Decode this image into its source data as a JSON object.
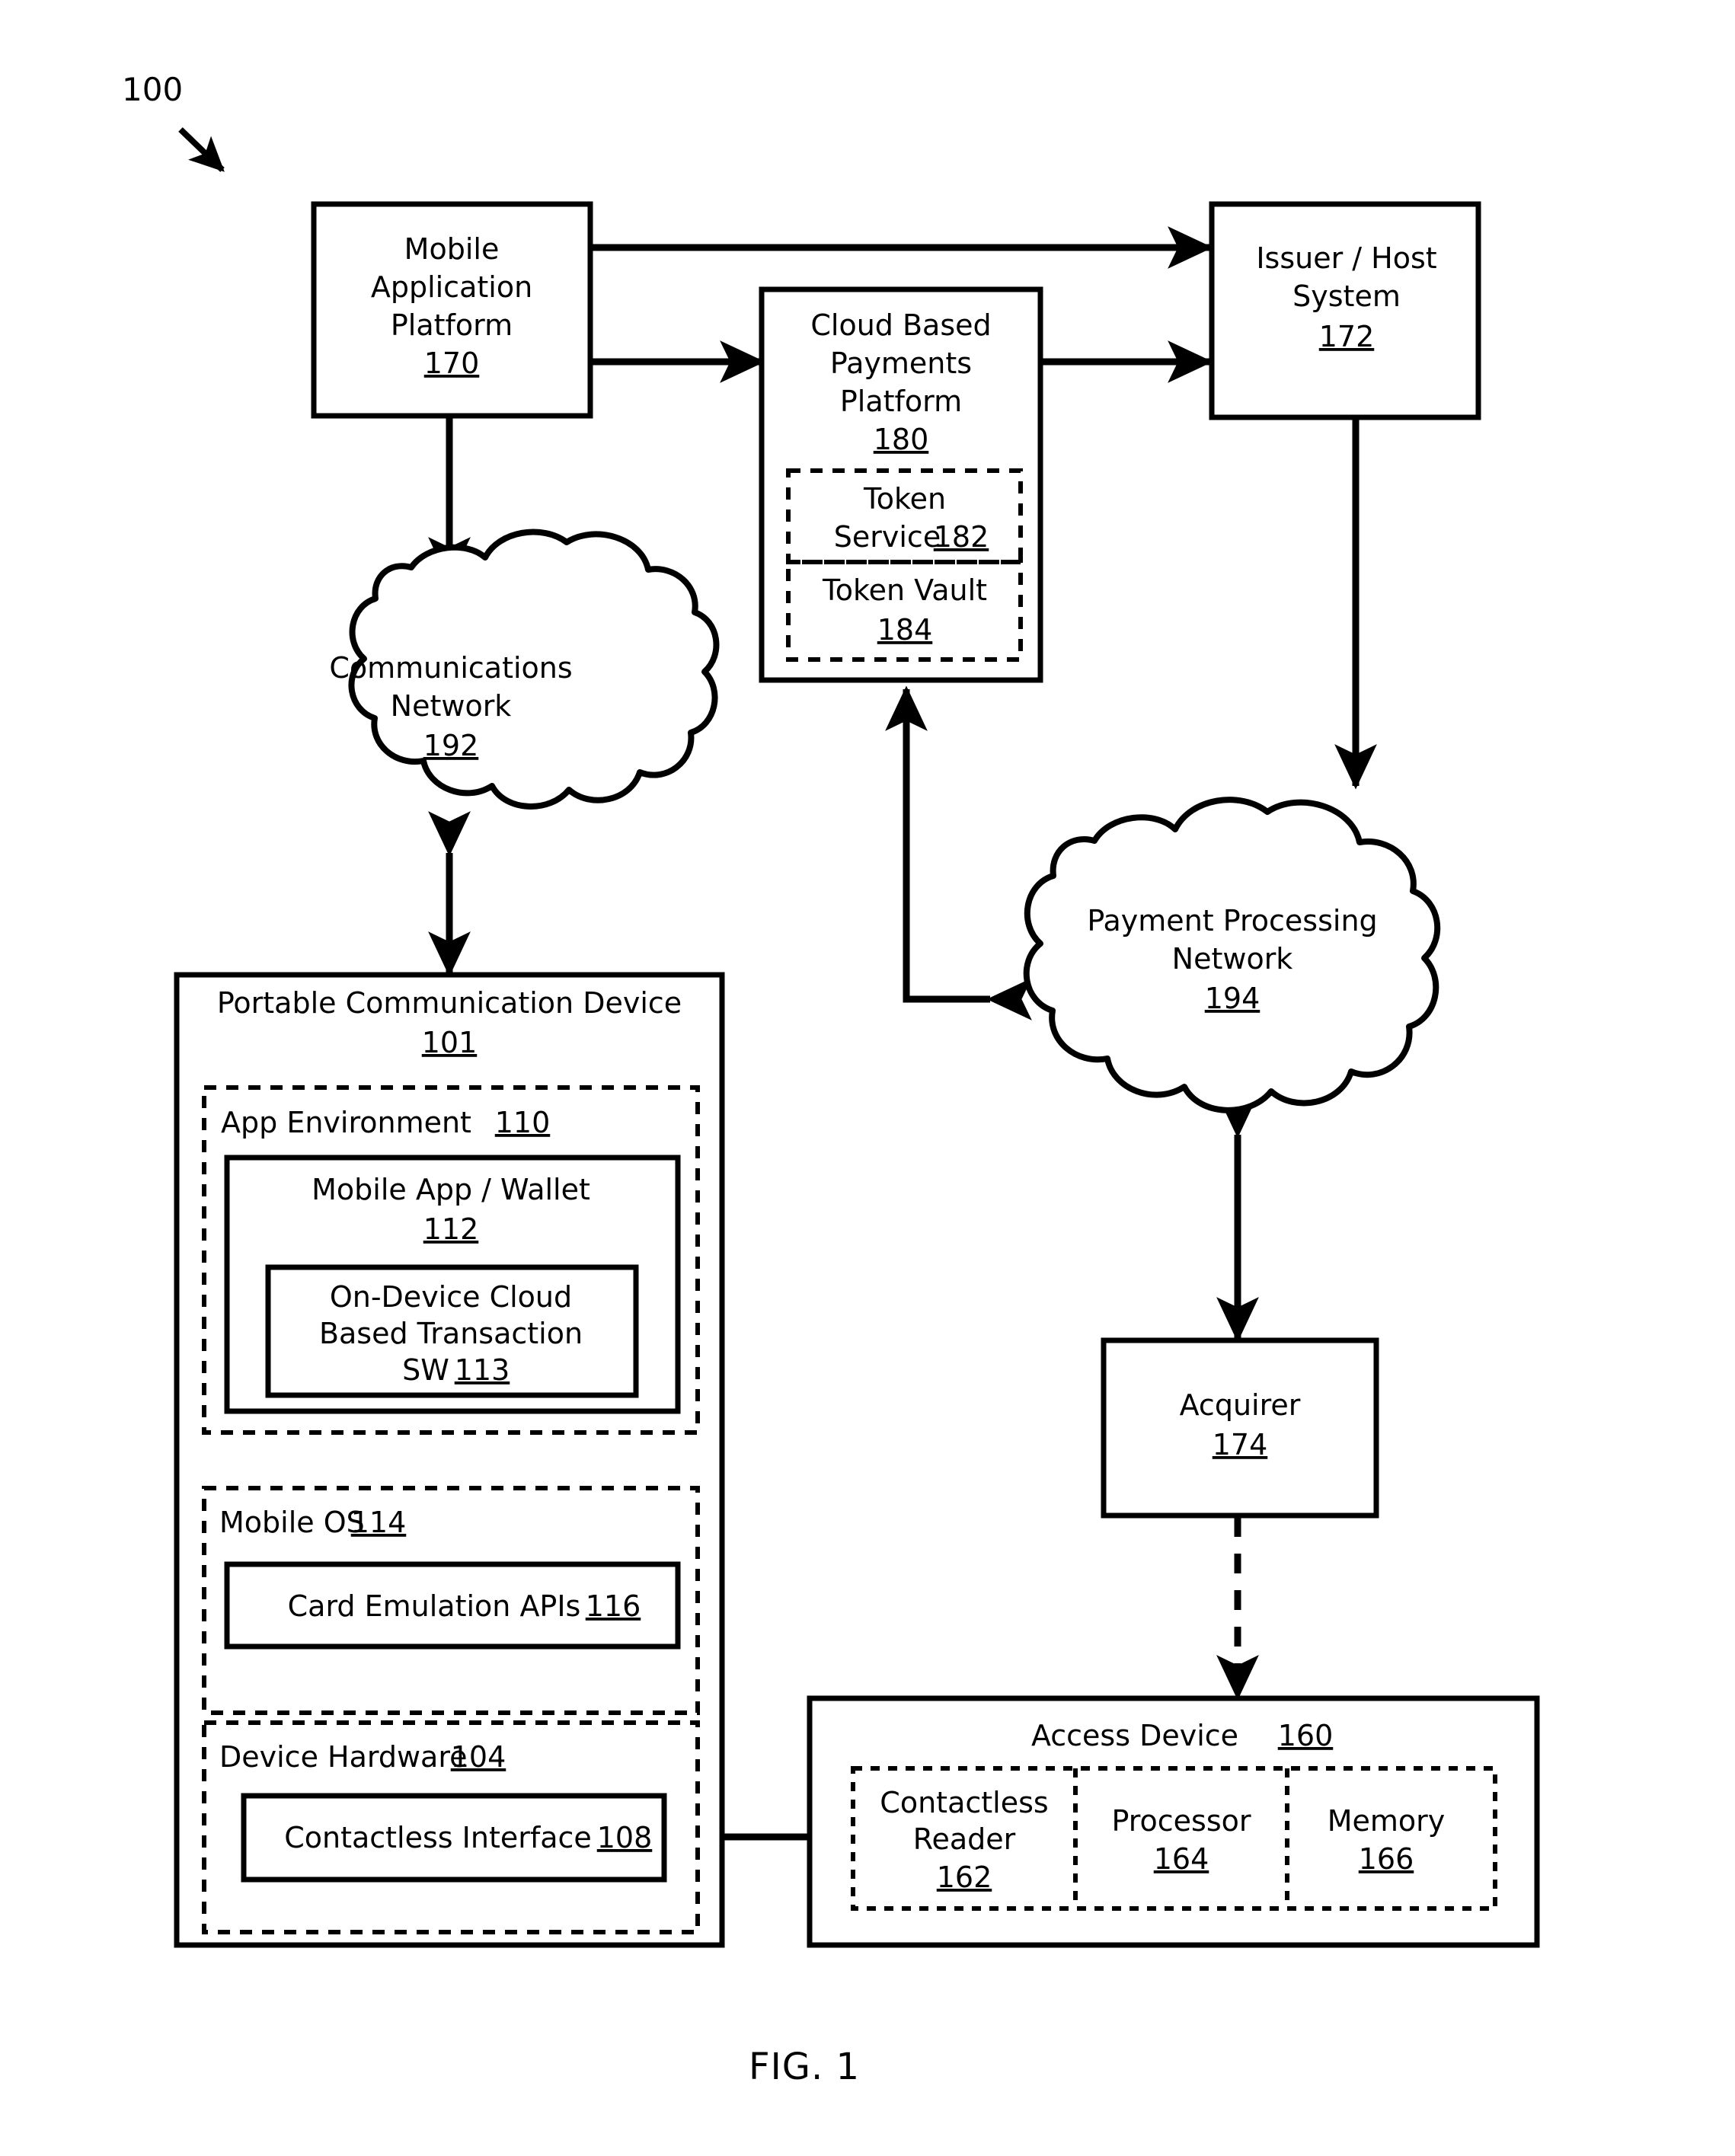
{
  "figure": {
    "number_callout": "100",
    "caption": "FIG. 1"
  },
  "nodes": {
    "mobile_application_platform": {
      "line1": "Mobile",
      "line2": "Application",
      "line3": "Platform",
      "ref": "170"
    },
    "cloud_based_payments_platform": {
      "line1": "Cloud Based",
      "line2": "Payments",
      "line3": "Platform",
      "ref": "180",
      "children": {
        "token_service": {
          "line1": "Token",
          "line2": "Service",
          "ref": "182"
        },
        "token_vault": {
          "line1": "Token Vault",
          "ref": "184"
        }
      }
    },
    "issuer_host_system": {
      "line1": "Issuer / Host",
      "line2": "System",
      "ref": "172"
    },
    "communications_network": {
      "line1": "Communications",
      "line2": "Network",
      "ref": "192"
    },
    "payment_processing_network": {
      "line1": "Payment Processing",
      "line2": "Network",
      "ref": "194"
    },
    "acquirer": {
      "line1": "Acquirer",
      "ref": "174"
    },
    "portable_communication_device": {
      "title": "Portable Communication Device",
      "ref": "101",
      "app_environment": {
        "title": "App Environment",
        "ref": "110",
        "mobile_app_wallet": {
          "line1": "Mobile App / Wallet",
          "ref": "112",
          "on_device_sw": {
            "line1": "On-Device Cloud",
            "line2": "Based Transaction",
            "line3": "SW",
            "ref": "113"
          }
        }
      },
      "mobile_os": {
        "title": "Mobile OS",
        "ref": "114",
        "card_emulation_apis": {
          "title": "Card Emulation APIs",
          "ref": "116"
        }
      },
      "device_hardware": {
        "title": "Device Hardware",
        "ref": "104",
        "contactless_interface": {
          "title": "Contactless Interface",
          "ref": "108"
        }
      }
    },
    "access_device": {
      "title": "Access Device",
      "ref": "160",
      "contactless_reader": {
        "line1": "Contactless",
        "line2": "Reader",
        "ref": "162"
      },
      "processor": {
        "line1": "Processor",
        "ref": "164"
      },
      "memory": {
        "line1": "Memory",
        "ref": "166"
      }
    }
  },
  "connections": [
    {
      "name": "map-to-issuer",
      "from": "mobile_application_platform",
      "to": "issuer_host_system",
      "style": "solid",
      "arrows": "both"
    },
    {
      "name": "map-to-cbpp",
      "from": "mobile_application_platform",
      "to": "cloud_based_payments_platform",
      "style": "solid",
      "arrows": "both"
    },
    {
      "name": "cbpp-to-issuer",
      "from": "cloud_based_payments_platform",
      "to": "issuer_host_system",
      "style": "solid",
      "arrows": "both"
    },
    {
      "name": "map-to-commnet",
      "from": "mobile_application_platform",
      "to": "communications_network",
      "style": "solid",
      "arrows": "both"
    },
    {
      "name": "commnet-to-device",
      "from": "communications_network",
      "to": "portable_communication_device",
      "style": "solid",
      "arrows": "both"
    },
    {
      "name": "issuer-to-ppn",
      "from": "issuer_host_system",
      "to": "payment_processing_network",
      "style": "solid",
      "arrows": "both"
    },
    {
      "name": "ppn-to-cbpp",
      "from": "payment_processing_network",
      "to": "cloud_based_payments_platform",
      "style": "solid",
      "arrows": "both"
    },
    {
      "name": "ppn-to-acquirer",
      "from": "payment_processing_network",
      "to": "acquirer",
      "style": "solid",
      "arrows": "both"
    },
    {
      "name": "acquirer-to-access-device",
      "from": "acquirer",
      "to": "access_device",
      "style": "dashed",
      "arrows": "both"
    },
    {
      "name": "sw-to-card-apis",
      "from": "on_device_sw",
      "to": "card_emulation_apis",
      "style": "solid",
      "arrows": "both"
    },
    {
      "name": "card-apis-to-contactless-interface",
      "from": "card_emulation_apis",
      "to": "contactless_interface",
      "style": "solid",
      "arrows": "both"
    },
    {
      "name": "contactless-interface-to-reader",
      "from": "contactless_interface",
      "to": "contactless_reader",
      "style": "solid",
      "arrows": "both"
    }
  ],
  "colors": {
    "stroke": "#000000",
    "fill": "#ffffff"
  }
}
